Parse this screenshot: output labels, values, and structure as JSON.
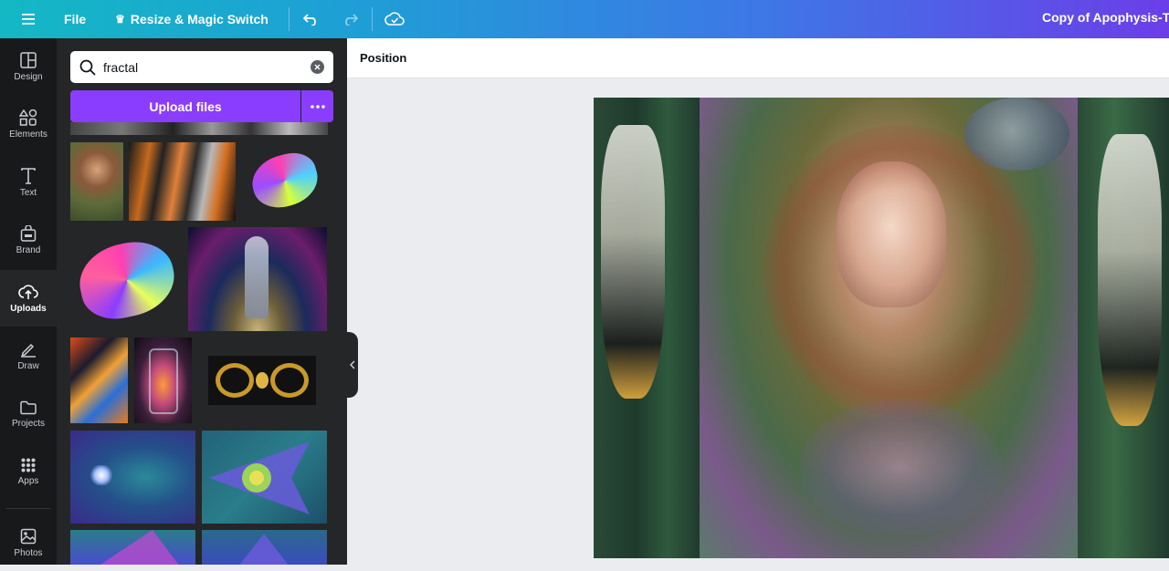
{
  "topbar": {
    "file_label": "File",
    "resize_label": "Resize & Magic Switch",
    "doc_title": "Copy of Apophysis-The"
  },
  "rail": {
    "items": [
      {
        "label": "Design",
        "icon": "layout-icon"
      },
      {
        "label": "Elements",
        "icon": "shapes-icon"
      },
      {
        "label": "Text",
        "icon": "text-icon"
      },
      {
        "label": "Brand",
        "icon": "brand-icon"
      },
      {
        "label": "Uploads",
        "icon": "cloud-upload-icon",
        "active": true
      },
      {
        "label": "Draw",
        "icon": "pen-icon"
      },
      {
        "label": "Projects",
        "icon": "folder-icon"
      },
      {
        "label": "Apps",
        "icon": "grid-icon"
      },
      {
        "label": "Photos",
        "icon": "image-icon"
      }
    ]
  },
  "panel": {
    "search_value": "fractal",
    "upload_label": "Upload files"
  },
  "context_bar": {
    "position_label": "Position"
  },
  "colors": {
    "accent": "#8b3dff",
    "rail_bg": "#18191b",
    "panel_bg": "#252627",
    "canvas_bg": "#ebecf0"
  }
}
